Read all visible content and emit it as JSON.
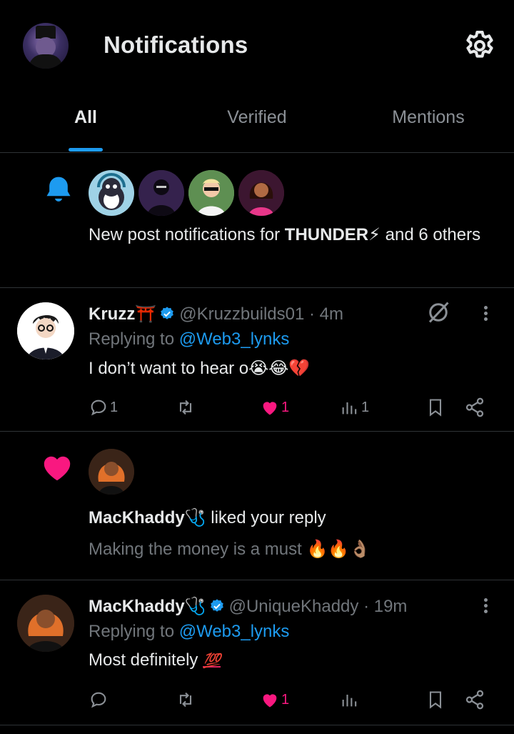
{
  "header": {
    "title": "Notifications",
    "avatar_icon": "profile-avatar",
    "settings_icon": "gear-icon"
  },
  "tabs": [
    {
      "label": "All",
      "active": true
    },
    {
      "label": "Verified",
      "active": false
    },
    {
      "label": "Mentions",
      "active": false
    }
  ],
  "bell_notification": {
    "icon": "bell-icon",
    "text_prefix": "New post notifications for ",
    "bold_name": "THUNDER⚡",
    "text_suffix": " and 6 others"
  },
  "tweet1": {
    "name": "Kruzz⛩️",
    "handle": "@Kruzzbuilds01",
    "time": "· 4m",
    "replying_prefix": "Replying to ",
    "replying_handle": "@Web3_lynks",
    "body": "I don’t want to hear o😭😂💔",
    "replies": "1",
    "likes": "1",
    "views": "1"
  },
  "like_notification": {
    "name": "MacKhaddy🩺",
    "action": " liked your reply",
    "quote": "Making the money is a must 🔥🔥👌🏽"
  },
  "tweet2": {
    "name": "MacKhaddy🩺",
    "handle": "@UniqueKhaddy",
    "time": "· 19m",
    "replying_prefix": "Replying to ",
    "replying_handle": "@Web3_lynks",
    "body": "Most definitely ",
    "body_emoji": "💯",
    "likes": "1"
  },
  "colors": {
    "background": "#000000",
    "accent_blue": "#1d9bf0",
    "like_pink": "#f91880",
    "divider": "#2f3336",
    "dim_text": "#71767b"
  }
}
